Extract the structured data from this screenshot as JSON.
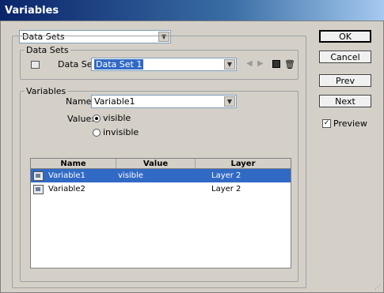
{
  "window": {
    "title": "Variables"
  },
  "top_dropdown": {
    "value": "Data Sets"
  },
  "data_sets_group": {
    "label": "Data Sets",
    "data_set_label": "Data Set:",
    "data_set_value": "Data Set 1"
  },
  "variables_group": {
    "label": "Variables",
    "name_label": "Name:",
    "name_value": "Variable1",
    "value_label": "Value:",
    "radio_visible": "visible",
    "radio_invisible": "invisible"
  },
  "table": {
    "headers": [
      "Name",
      "Value",
      "Layer"
    ],
    "rows": [
      {
        "name": "Variable1",
        "value": "visible",
        "layer": "Layer 2"
      },
      {
        "name": "Variable2",
        "value": "",
        "layer": "Layer 2"
      }
    ]
  },
  "buttons": {
    "ok": "OK",
    "cancel": "Cancel",
    "prev": "Prev",
    "next": "Next"
  },
  "preview": {
    "label": "Preview",
    "checked": true
  }
}
